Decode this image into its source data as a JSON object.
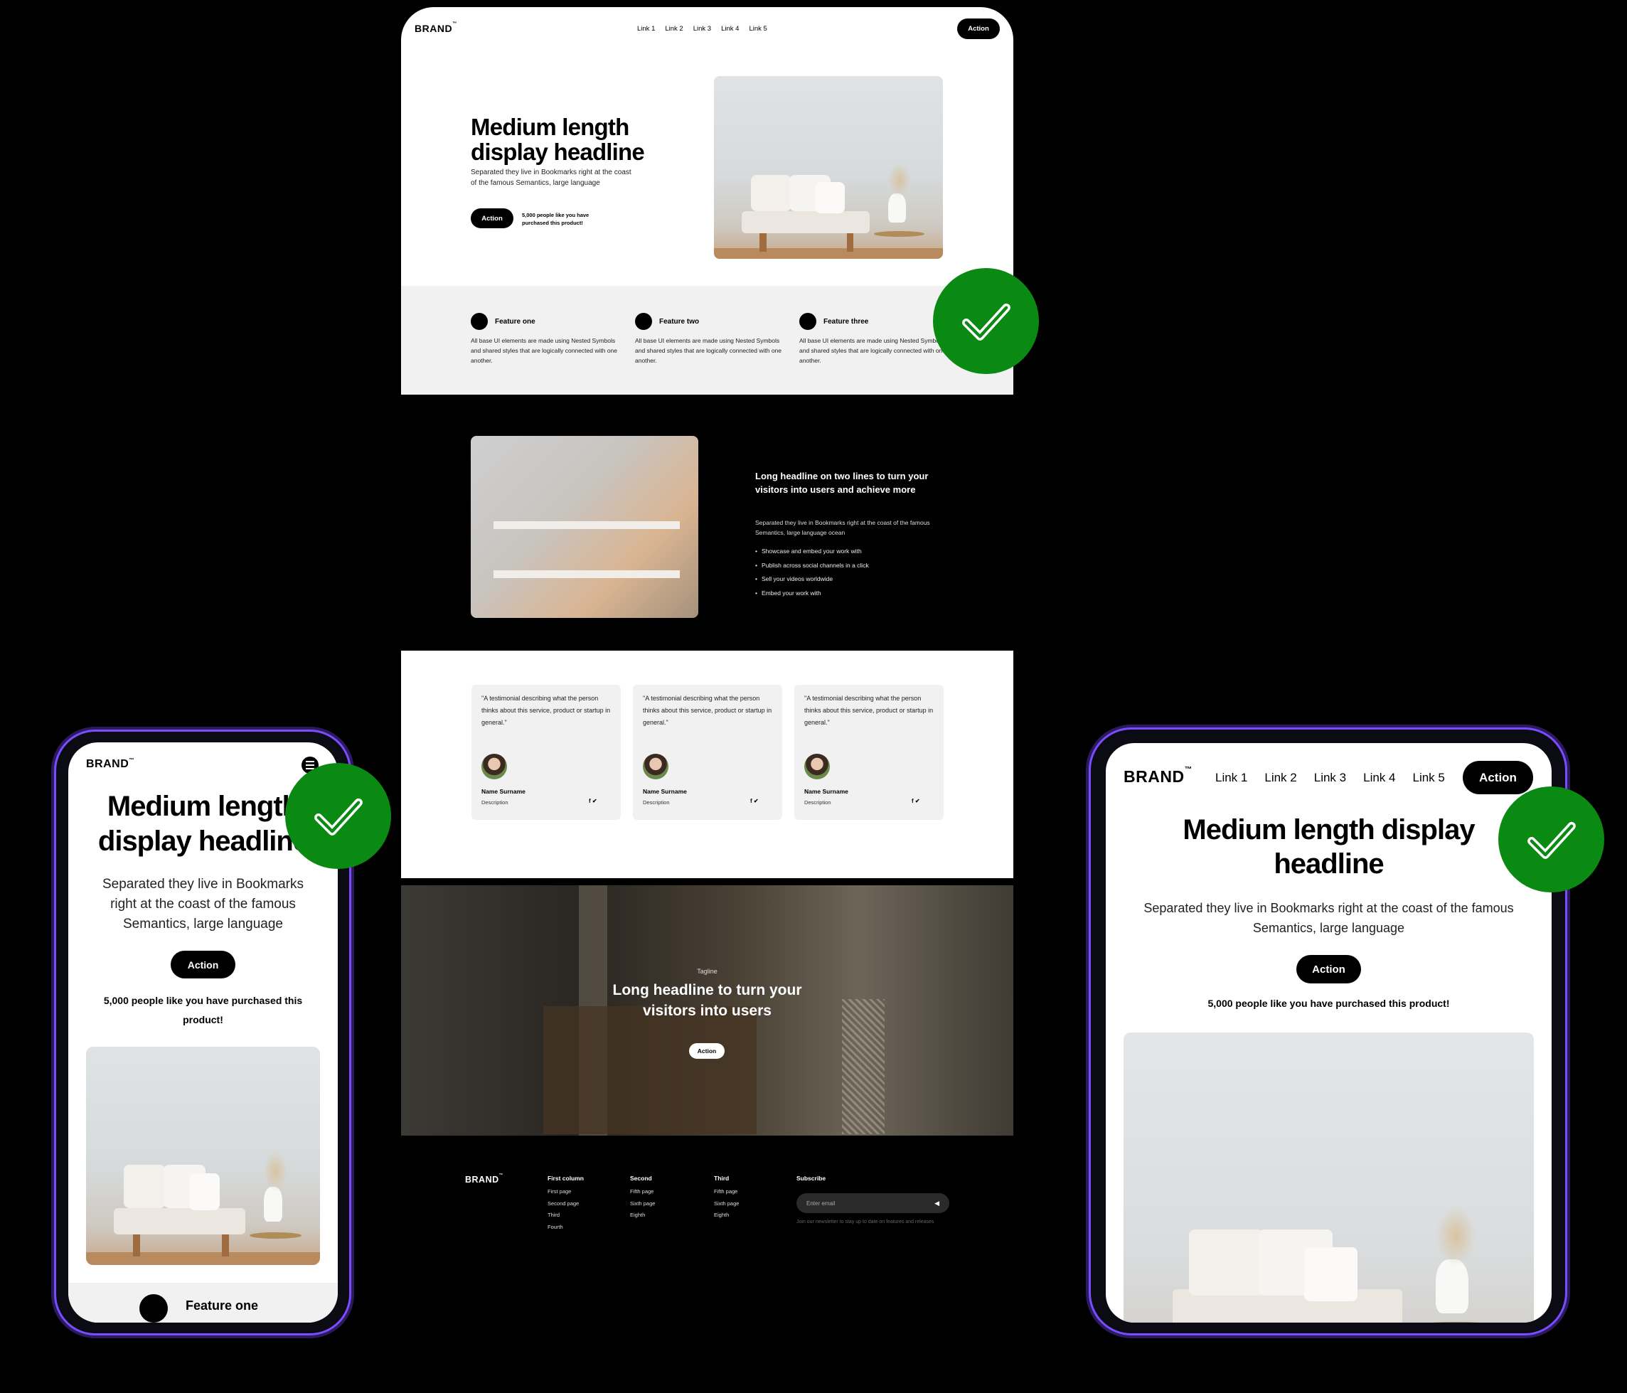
{
  "colors": {
    "accent_check": "#0a8a12",
    "phone_frame": "#7a4bff",
    "dark_bg": "#000000",
    "light_section": "#f1f1f1"
  },
  "desktop": {
    "brand": "BRAND",
    "brand_mark": "™",
    "nav_links": [
      "Link 1",
      "Link 2",
      "Link 3",
      "Link 4",
      "Link 5"
    ],
    "nav_action": "Action",
    "hero": {
      "headline_line1": "Medium length",
      "headline_line2": "display headline",
      "subtext_line1": "Separated they live in Bookmarks right at the coast",
      "subtext_line2": "of the famous Semantics, large language",
      "action": "Action",
      "social_line1": "5,000 people like you have",
      "social_line2": "purchased this product!"
    },
    "features": [
      {
        "title": "Feature one",
        "desc": "All base UI elements are made using Nested Symbols and shared styles that are logically connected with one another."
      },
      {
        "title": "Feature two",
        "desc": "All base UI elements are made using Nested Symbols and shared styles that are logically connected with one another."
      },
      {
        "title": "Feature three",
        "desc": "All base UI elements are made using Nested Symbols and shared styles that are logically connected with one another."
      }
    ],
    "media": {
      "headline": "Long headline on two lines to turn your visitors into users and achieve more",
      "text": "Separated they live in Bookmarks right at the coast of the famous Semantics, large language ocean",
      "bullets": [
        "Showcase and embed your work with",
        "Publish across social channels in a click",
        "Sell your videos worldwide",
        "Embed your work with"
      ]
    },
    "testimonials": [
      {
        "quote": "\"A testimonial describing what the person thinks about this service, product or startup in general.\"",
        "name": "Name Surname",
        "desc": "Description",
        "icons": "f ✔"
      },
      {
        "quote": "\"A testimonial describing what the person thinks about this service, product or startup in general.\"",
        "name": "Name Surname",
        "desc": "Description",
        "icons": "f ✔"
      },
      {
        "quote": "\"A testimonial describing what the person thinks about this service, product or startup in general.\"",
        "name": "Name Surname",
        "desc": "Description",
        "icons": "f ✔"
      }
    ],
    "cta": {
      "tagline": "Tagline",
      "headline_line1": "Long headline to turn your",
      "headline_line2": "visitors into users",
      "action": "Action"
    },
    "footer": {
      "brand": "BRAND",
      "columns": [
        {
          "title": "First column",
          "items": [
            "First page",
            "Second page",
            "Third",
            "Fourth"
          ]
        },
        {
          "title": "Second",
          "items": [
            "Fifth page",
            "Sixth page",
            "Eighth"
          ]
        },
        {
          "title": "Third",
          "items": [
            "Fifth page",
            "Sixth page",
            "Eighth"
          ]
        }
      ],
      "subscribe_title": "Subscribe",
      "email_placeholder": "Enter email",
      "newsletter_note": "Join our newsletter to stay up to date on features and releases"
    }
  },
  "mobile": {
    "brand": "BRAND",
    "headline_line1": "Medium length",
    "headline_line2": "display headline",
    "subtext": "Separated they live in Bookmarks right at the coast of the famous Semantics, large language",
    "action": "Action",
    "social": "5,000 people like you have purchased this product!",
    "feature_title": "Feature one"
  },
  "tablet": {
    "brand": "BRAND",
    "nav_links": [
      "Link 1",
      "Link 2",
      "Link 3",
      "Link 4",
      "Link 5"
    ],
    "nav_action": "Action",
    "headline": "Medium length display headline",
    "subtext": "Separated they live in Bookmarks right at the coast of the famous Semantics, large language",
    "action": "Action",
    "social": "5,000 people like you have purchased this product!"
  }
}
